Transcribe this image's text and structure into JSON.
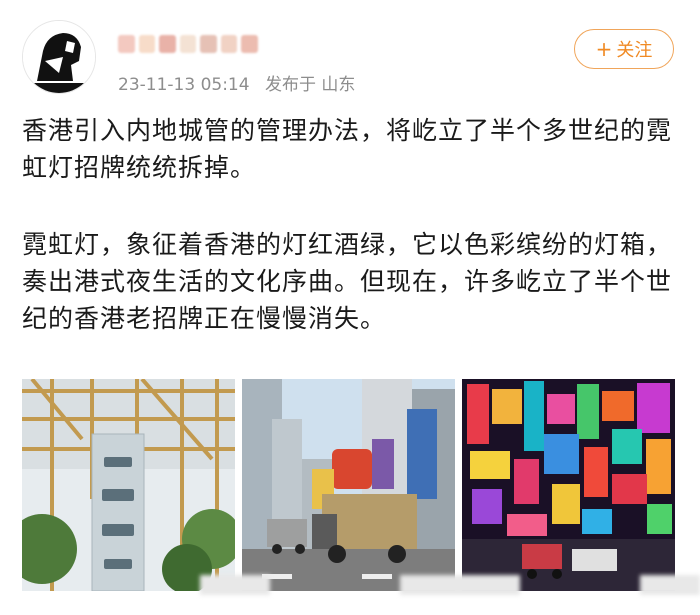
{
  "post": {
    "timestamp": "23-11-13 05:14",
    "location": "发布于 山东",
    "follow_label": "关注",
    "follow_plus": "+",
    "paragraphs": [
      "香港引入内地城管的管理办法，将屹立了半个多世纪的霓虹灯招牌统统拆掉。",
      "霓虹灯，象征着香港的灯红酒绿，它以色彩缤纷的灯箱，奏出港式夜生活的文化序曲。但现在，许多屹立了半个世纪的香港老招牌正在慢慢消失。"
    ]
  },
  "images": [
    {
      "icon": "scaffold-sign-photo"
    },
    {
      "icon": "truck-removing-sign-photo"
    },
    {
      "icon": "neon-street-photo"
    }
  ],
  "colors": {
    "follow_accent": "#f08a24",
    "meta_gray": "#8d8d8d"
  }
}
